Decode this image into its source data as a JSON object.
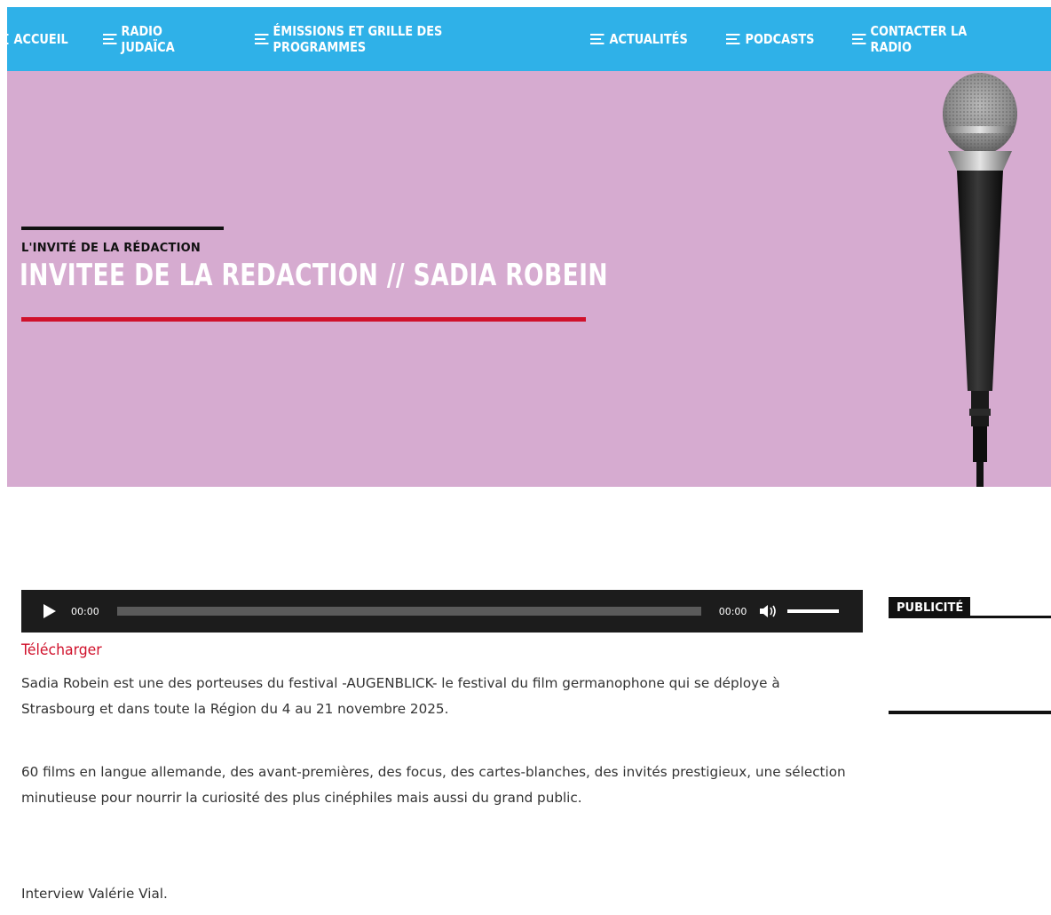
{
  "nav": {
    "items": [
      {
        "label": "ACCUEIL"
      },
      {
        "label": "RADIO JUDAÏCA"
      },
      {
        "label": "ÉMISSIONS ET GRILLE DES PROGRAMMES"
      },
      {
        "label": "ACTUALITÉS"
      },
      {
        "label": "PODCASTS"
      },
      {
        "label": "CONTACTER LA RADIO"
      }
    ],
    "icon": "menu-lines-icon",
    "background": "#2fb1e8"
  },
  "hero": {
    "kicker": "L'INVITÉ DE LA RÉDACTION",
    "title": "INVITEE DE LA REDACTION // SADIA ROBEIN",
    "background": "#d6abd0",
    "accent": "#d0112b",
    "image": "microphone-icon"
  },
  "player": {
    "current_time": "00:00",
    "duration": "00:00",
    "progress": 0,
    "volume": 1.0,
    "play_icon": "play-icon",
    "volume_icon": "volume-icon"
  },
  "article": {
    "download_label": "Télécharger",
    "paragraphs": [
      "Sadia Robein est une des porteuses du festival -AUGENBLICK- le festival du film germanophone qui se déploye à Strasbourg et dans toute la Région du 4 au 21 novembre 2025.",
      "60 films en langue allemande, des avant-premières, des focus, des cartes-blanches, des invités prestigieux, une sélection minutieuse pour nourrir la curiosité des plus cinéphiles mais aussi du grand public.",
      "Interview Valérie Vial."
    ]
  },
  "sidebar": {
    "publicite_label": "PUBLICITÉ"
  }
}
